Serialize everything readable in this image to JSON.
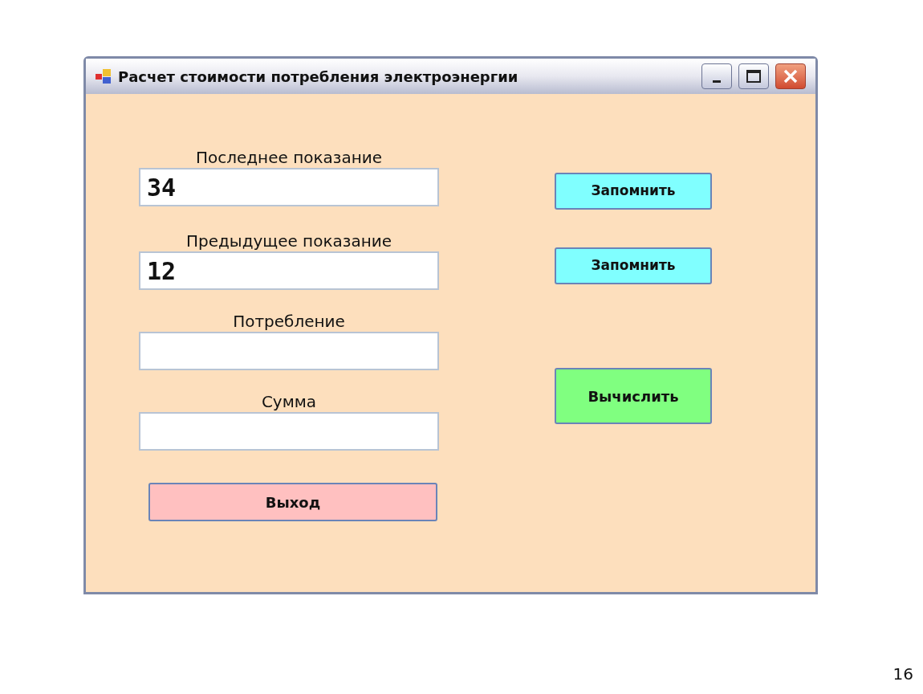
{
  "window": {
    "title": "Расчет стоимости потребления электроэнергии"
  },
  "fields": [
    {
      "label": "Последнее показание",
      "value": "34"
    },
    {
      "label": "Предыдущее показание",
      "value": "12"
    },
    {
      "label": "Потребление"
    },
    {
      "label": "Сумма"
    }
  ],
  "buttons": [
    {
      "label": "Запомнить",
      "kind": "save"
    },
    {
      "label": "Запомнить",
      "kind": "save"
    },
    {
      "label": "Вычислить",
      "kind": "compute"
    }
  ],
  "exit_button": {
    "label": "Выход"
  },
  "slide_number": "16"
}
